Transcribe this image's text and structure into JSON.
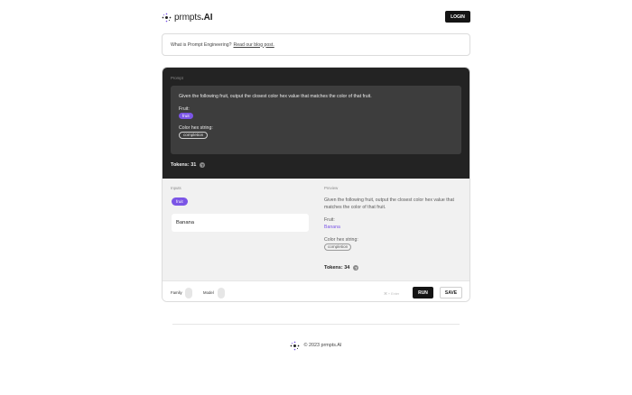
{
  "header": {
    "logo_text": "prmpts",
    "logo_suffix": ".AI",
    "login_label": "LOGIN"
  },
  "banner": {
    "text": "What is Prompt Engineering?",
    "link": "Read our blog post."
  },
  "prompt": {
    "section_label": "Prompt",
    "instruction": "Given the following fruit, output the closest color hex value that matches the color of that fruit.",
    "fruit_label": "Fruit:",
    "fruit_pill": "fruit",
    "color_label": "Color hex string:",
    "completion_pill": "completion",
    "tokens": "Tokens: 31",
    "help_glyph": "?"
  },
  "inputs": {
    "section_label": "Inputs",
    "pill": "fruit",
    "value": "Banana"
  },
  "preview": {
    "section_label": "Preview",
    "instruction": "Given the following fruit, output the closest color hex value that matches the color of that fruit.",
    "fruit_label": "Fruit:",
    "fruit_value": "Banana",
    "color_label": "Color hex string:",
    "completion_pill": "completion",
    "tokens": "Tokens: 34",
    "help_glyph": "?"
  },
  "bottom": {
    "family_label": "Family",
    "model_label": "Model",
    "hint": "⌘ + Enter",
    "run_label": "RUN",
    "save_label": "SAVE"
  },
  "footer": {
    "text": "© 2023 prmpts.AI"
  },
  "colors": {
    "accent": "#7b55e6",
    "dark": "#232323",
    "button": "#141414"
  },
  "icons": {
    "logo": "sparkle-cross-icon",
    "help": "question-circle-icon"
  }
}
